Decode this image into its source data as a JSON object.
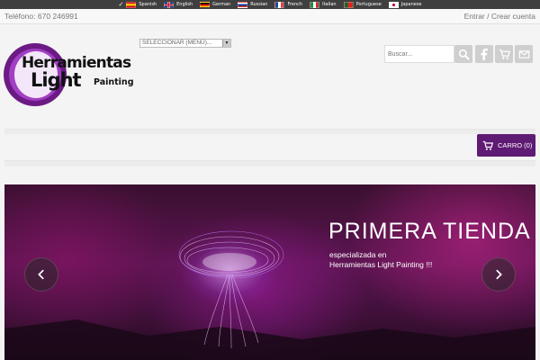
{
  "languages": [
    {
      "label": "Spanish",
      "flag": "es",
      "selected": true
    },
    {
      "label": "English",
      "flag": "en"
    },
    {
      "label": "German",
      "flag": "de"
    },
    {
      "label": "Russian",
      "flag": "ru"
    },
    {
      "label": "French",
      "flag": "fr"
    },
    {
      "label": "Italian",
      "flag": "it"
    },
    {
      "label": "Portuguese",
      "flag": "pt"
    },
    {
      "label": "Japanese",
      "flag": "jp"
    }
  ],
  "topbar": {
    "phone": "Teléfono: 670 246991",
    "login": "Entrar",
    "separator": " / ",
    "register": "Crear cuenta"
  },
  "logo": {
    "line1": "Herramientas",
    "line2": "Light",
    "line3": "Painting"
  },
  "menu": {
    "selected": "SELECCIONAR (MENÚ)..."
  },
  "search": {
    "placeholder": "Buscar..."
  },
  "icons": {
    "search_button": "search-icon",
    "facebook": "facebook-icon",
    "cart": "cart-icon",
    "mail": "mail-icon"
  },
  "cart": {
    "label": "CARRO (0)"
  },
  "hero": {
    "title": "PRIMERA TIENDA",
    "subtitle_line1": "especializada en",
    "subtitle_line2": "Herramientas Light Painting !!!"
  },
  "colors": {
    "accent": "#5f1a74",
    "logo_purple": "#6c1b85",
    "langbar": "#3f3f3f",
    "icon_gray": "#cfcfcf"
  }
}
